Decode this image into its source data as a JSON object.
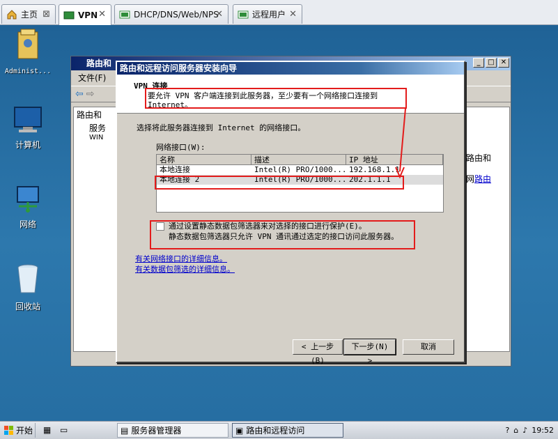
{
  "tabs": [
    {
      "label": "主页",
      "icon": "home-icon",
      "active": false
    },
    {
      "label": "VPN",
      "icon": "vm-icon",
      "active": true
    },
    {
      "label": "DHCP/DNS/Web/NPS",
      "icon": "vm-icon",
      "active": false
    },
    {
      "label": "远程用户",
      "icon": "vm-icon",
      "active": false
    }
  ],
  "desktop": {
    "icons": [
      {
        "label": "Administ...",
        "icon": "user-folder-icon"
      },
      {
        "label": "计算机",
        "icon": "computer-icon"
      },
      {
        "label": "网络",
        "icon": "network-icon"
      },
      {
        "label": "回收站",
        "icon": "recycle-bin-icon"
      }
    ]
  },
  "mmc": {
    "title": "路由和",
    "menu_file": "文件(F)",
    "tree": [
      "路由和",
      "服务",
      "WIN"
    ],
    "right_text": "路由和",
    "right_link_prefix": "网",
    "right_link": "路由"
  },
  "wizard": {
    "title": "路由和远程访问服务器安装向导",
    "header_title": "VPN 连接",
    "header_subtitle": "要允许 VPN 客户端连接到此服务器，至少要有一个网络接口连接到 Internet。",
    "prompt": "选择将此服务器连接到 Internet 的网络接口。",
    "list_label": "网络接口(W):",
    "columns": [
      "名称",
      "描述",
      "IP 地址"
    ],
    "rows": [
      {
        "name": "本地连接",
        "desc": "Intel(R) PRO/1000...",
        "ip": "192.168.1.1",
        "selected": false
      },
      {
        "name": "本地连接 2",
        "desc": "Intel(R) PRO/1000...",
        "ip": "202.1.1.1",
        "selected": true
      }
    ],
    "filter_check_label": "通过设置静态数据包筛选器来对选择的接口进行保护(E)。",
    "filter_desc": "静态数据包筛选器只允许 VPN 通讯通过选定的接口访问此服务器。",
    "filter_checked": false,
    "links": [
      "有关网络接口的详细信息。",
      "有关数据包筛选的详细信息。"
    ],
    "buttons": {
      "back": "< 上一步(B)",
      "next": "下一步(N) >",
      "cancel": "取消"
    }
  },
  "taskbar": {
    "start": "开始",
    "tasks": [
      {
        "label": "服务器管理器",
        "active": false
      },
      {
        "label": "路由和远程访问",
        "active": true
      }
    ],
    "clock": "19:52"
  },
  "colors": {
    "annotation": "#e31b1b",
    "link": "#0000cc",
    "desktop": "#2b6792"
  }
}
